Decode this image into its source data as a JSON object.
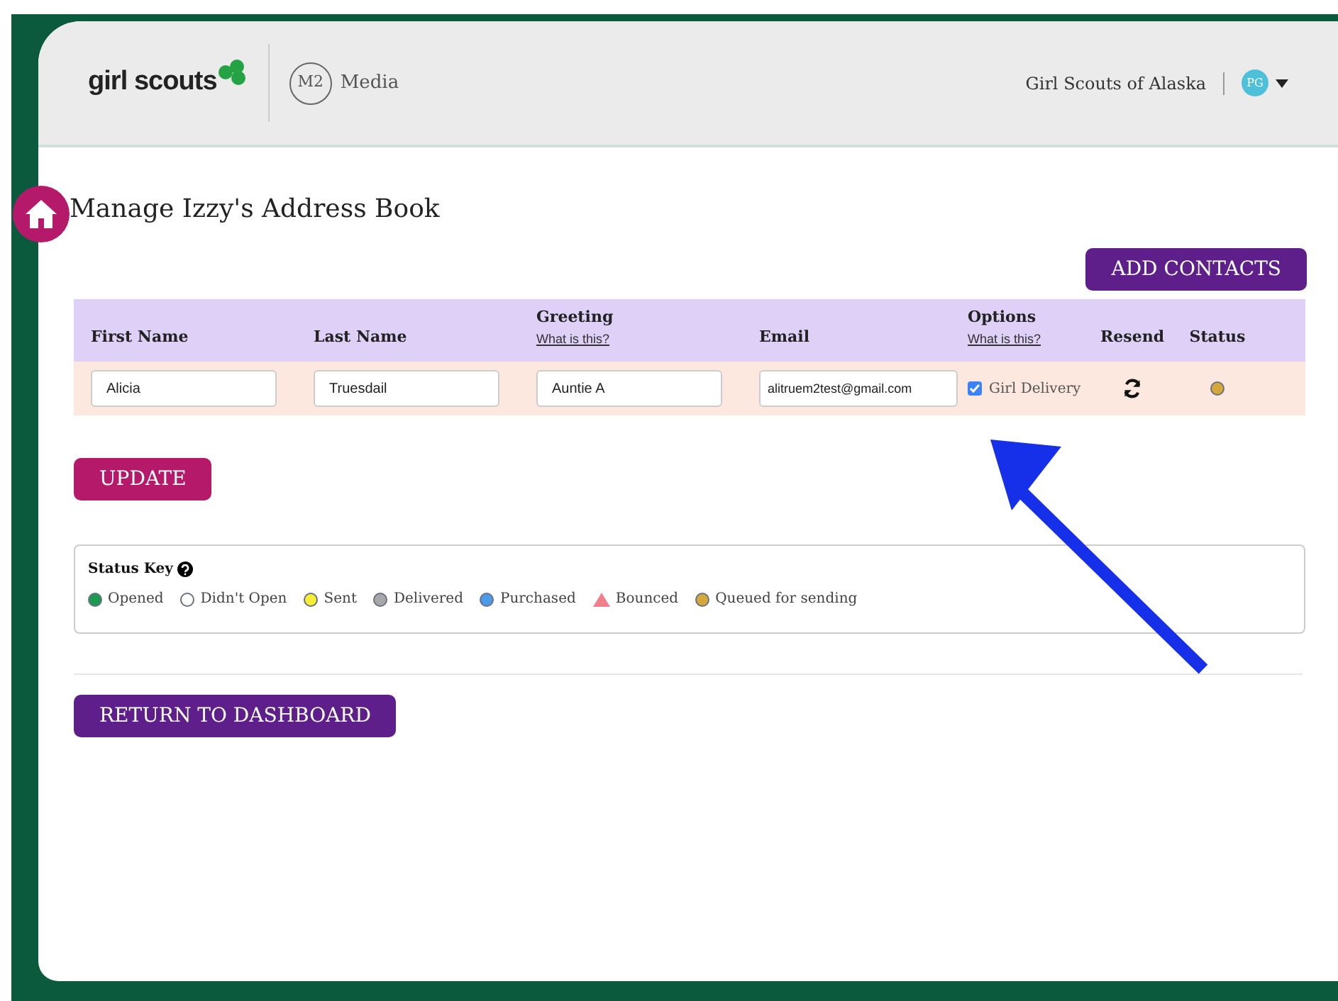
{
  "header": {
    "logo": "girl scouts",
    "partner": "Media",
    "partner_mark": "M2",
    "council": "Girl Scouts of Alaska",
    "avatar": "PG"
  },
  "page": {
    "title": "Manage Izzy's Address Book",
    "add_button": "ADD CONTACTS"
  },
  "table": {
    "columns": [
      {
        "label": "First Name"
      },
      {
        "label": "Last Name"
      },
      {
        "label": "Greeting",
        "help": "What is this?"
      },
      {
        "label": "Email"
      },
      {
        "label": "Options",
        "help": "What is this?"
      },
      {
        "label": "Resend"
      },
      {
        "label": "Status"
      }
    ],
    "rows": [
      {
        "first_name": "Alicia",
        "last_name": "Truesdail",
        "greeting": "Auntie A",
        "email": "alitruem2test@gmail.com",
        "option_label": "Girl Delivery",
        "checked": true,
        "color": "#d4a83a"
      }
    ]
  },
  "update_button": "UPDATE",
  "status_key": {
    "title": "Status Key",
    "items": [
      {
        "label": "Opened",
        "kind": "dot",
        "color": "#1a9b50"
      },
      {
        "label": "Didn't Open",
        "kind": "dot",
        "color": "#ffffff"
      },
      {
        "label": "Sent",
        "kind": "dot",
        "color": "#f5ee35"
      },
      {
        "label": "Delivered",
        "kind": "dot",
        "color": "#a8a8a8"
      },
      {
        "label": "Purchased",
        "kind": "dot",
        "color": "#4a9be8"
      },
      {
        "label": "Bounced",
        "kind": "triangle",
        "color": "#f07f8c"
      },
      {
        "label": "Queued for sending",
        "kind": "dot",
        "color": "#d4a83a"
      }
    ]
  },
  "return_button": "RETURN TO DASHBOARD"
}
